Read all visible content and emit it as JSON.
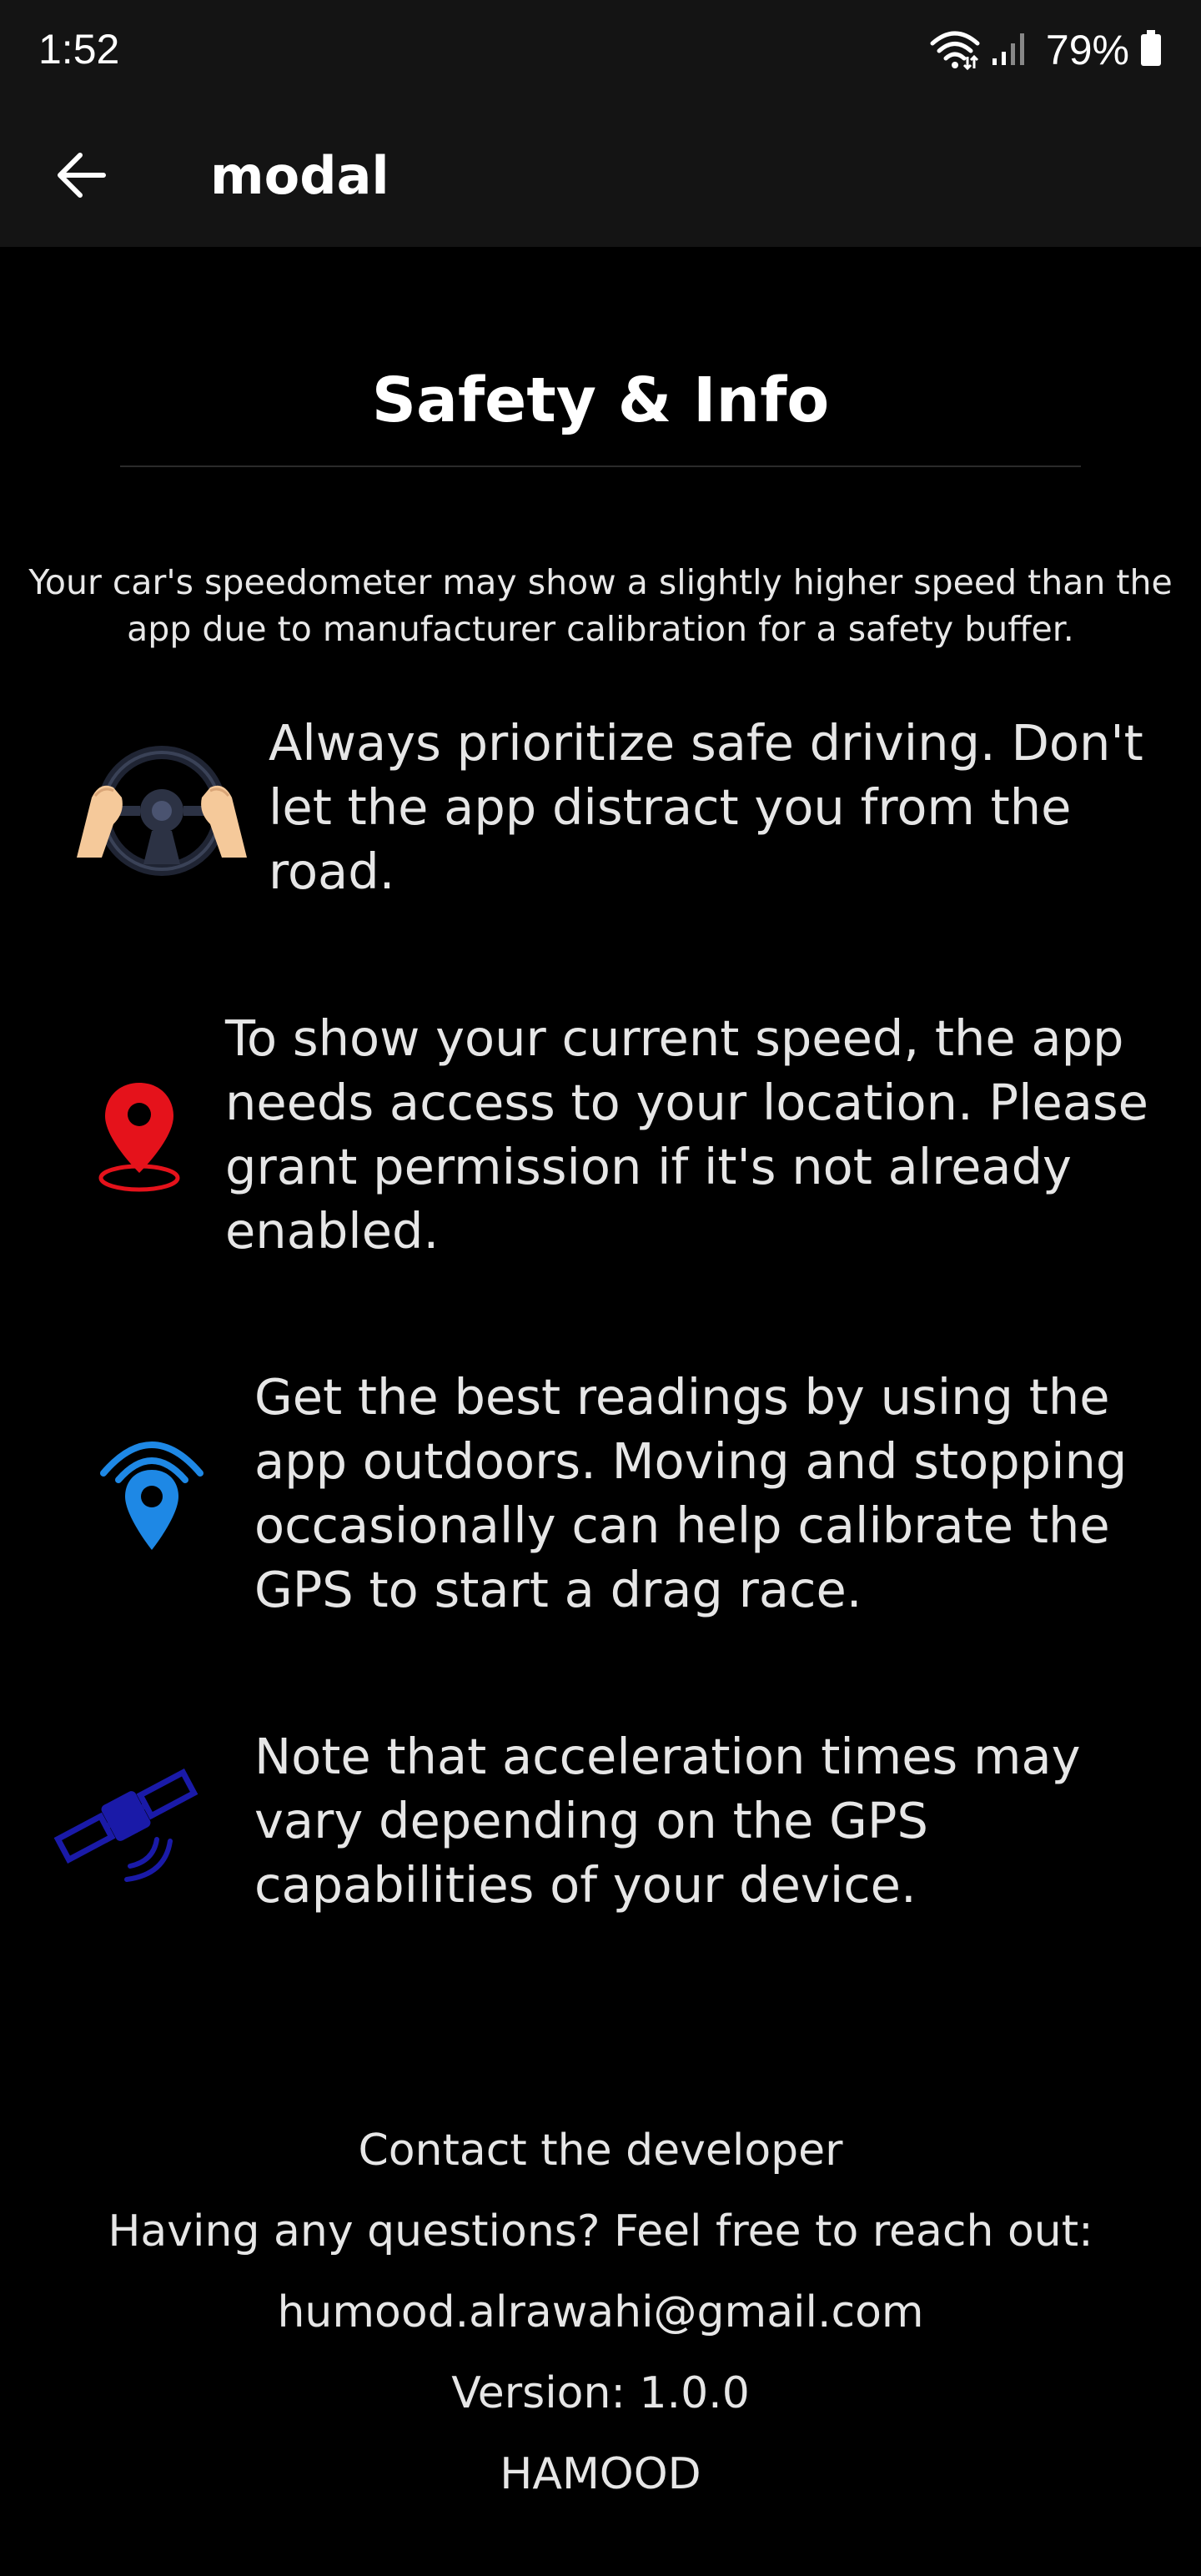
{
  "status_bar": {
    "time": "1:52",
    "battery": "79%",
    "icons": [
      "wifi-icon",
      "signal-icon",
      "battery-icon"
    ]
  },
  "app_bar": {
    "back_icon": "arrow-left-icon",
    "title": "modal"
  },
  "modal": {
    "title": "Safety & Info",
    "intro": "Your car's speedometer may show a slightly higher speed than the app due to manufacturer calibration for a safety buffer.",
    "tips": [
      {
        "icon": "steering-wheel-icon",
        "text": "Always prioritize safe driving. Don't let the app distract you from the road."
      },
      {
        "icon": "location-pin-icon",
        "text": "To show your current speed, the app needs access to your location. Please grant permission if it's not already enabled."
      },
      {
        "icon": "gps-signal-icon",
        "text": "Get the best readings by using the app outdoors. Moving and stopping occasionally can help calibrate the GPS to start a drag race."
      },
      {
        "icon": "satellite-icon",
        "text": "Note that acceleration times may vary depending on the GPS capabilities of your device."
      }
    ],
    "footer": {
      "contact_title": "Contact the developer",
      "question": "Having any questions? Feel free to reach out:",
      "email": "humood.alrawahi@gmail.com",
      "version": "Version: 1.0.0",
      "developer": "HAMOOD"
    }
  },
  "colors": {
    "background": "#000000",
    "bar": "#141414",
    "text": "#e6e6e6",
    "pin_red": "#e5121b",
    "gps_blue": "#1e88e5",
    "satellite_navy": "#1a1aa8"
  }
}
